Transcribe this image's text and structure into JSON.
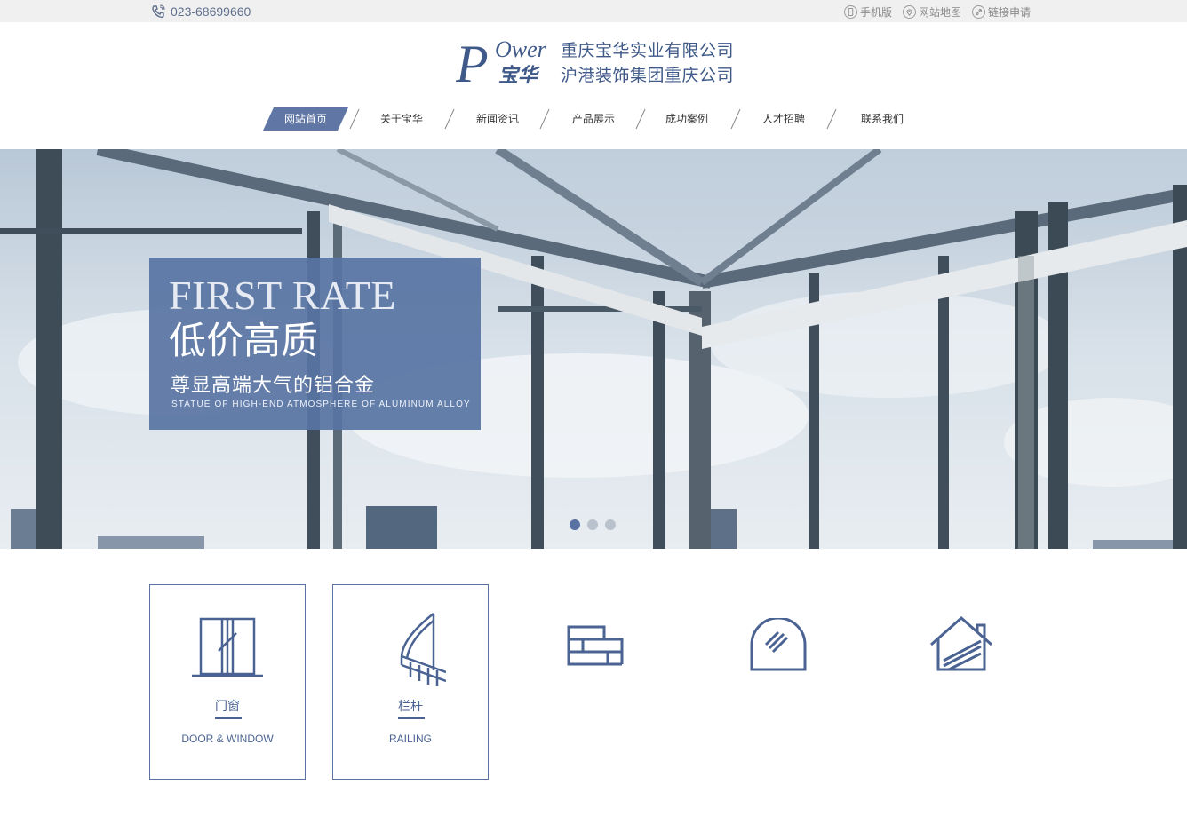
{
  "topbar": {
    "phone": "023-68699660",
    "links": [
      {
        "label": "手机版",
        "icon": "mobile-icon"
      },
      {
        "label": "网站地图",
        "icon": "map-pin-icon"
      },
      {
        "label": "链接申请",
        "icon": "link-icon"
      }
    ]
  },
  "header": {
    "logo_mark_text": "Ower",
    "logo_mark_letter": "P",
    "logo_mark_zh": "宝华",
    "company_line1": "重庆宝华实业有限公司",
    "company_line2": "沪港装饰集团重庆公司"
  },
  "nav": {
    "items": [
      {
        "label": "网站首页",
        "active": true
      },
      {
        "label": "关于宝华"
      },
      {
        "label": "新闻资讯"
      },
      {
        "label": "产品展示"
      },
      {
        "label": "成功案例"
      },
      {
        "label": "人才招聘"
      },
      {
        "label": "联系我们"
      }
    ]
  },
  "banner": {
    "title_en": "FIRST RATE",
    "title_zh": "低价高质",
    "subtitle_zh": "尊显高端大气的铝合金",
    "subtitle_en": "STATUE OF HIGH-END ATMOSPHERE OF ALUMINUM ALLOY",
    "slides": 3,
    "active_slide": 1
  },
  "categories": [
    {
      "zh": "门窗",
      "en": "DOOR & WINDOW",
      "icon": "door-window-icon",
      "framed": true
    },
    {
      "zh": "栏杆",
      "en": "RAILING",
      "icon": "railing-icon",
      "framed": true
    },
    {
      "zh": "",
      "en": "",
      "icon": "brick-wall-icon",
      "framed": false
    },
    {
      "zh": "",
      "en": "",
      "icon": "arch-window-icon",
      "framed": false
    },
    {
      "zh": "",
      "en": "",
      "icon": "house-icon",
      "framed": false
    }
  ],
  "colors": {
    "brand": "#5a72a2",
    "nav_active": "#6077a6",
    "topbar_bg": "#f0f0f0"
  }
}
